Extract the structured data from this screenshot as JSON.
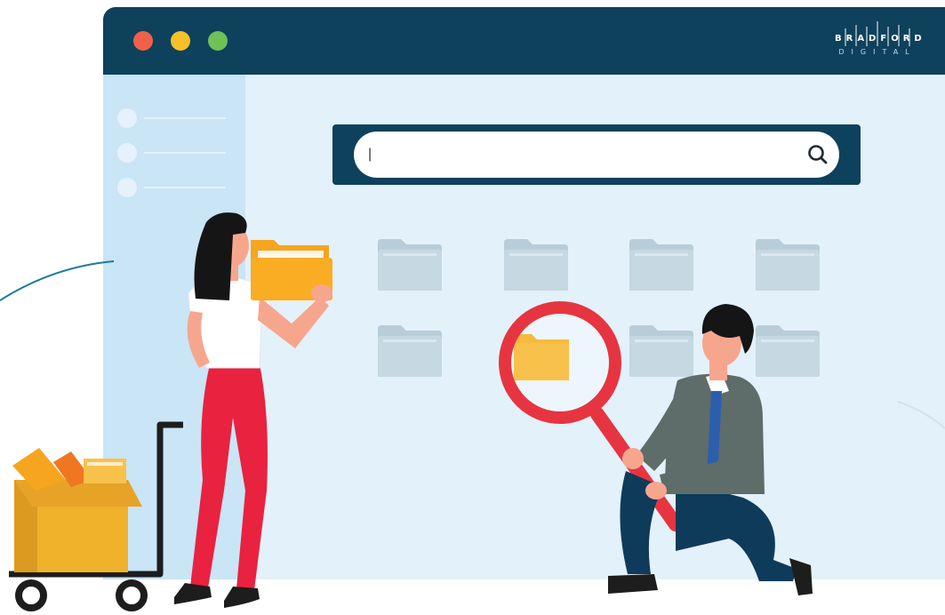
{
  "window": {
    "brand": {
      "name_top": "BRADFORD",
      "name_bottom": "DIGITAL"
    },
    "window_controls": [
      "close",
      "minimize",
      "maximize"
    ]
  },
  "search": {
    "value": "|",
    "placeholder": "",
    "icon": "search-icon"
  },
  "sidebar": {
    "items": [
      {},
      {},
      {}
    ]
  },
  "folders": {
    "rows": 2,
    "cols": 4
  },
  "colors": {
    "titlebar": "#0e415c",
    "window_bg": "#e3f1fb",
    "sidebar_bg": "#c9e5f6",
    "folder_gray": "#c6d8e2",
    "folder_yellow": "#f8ad23",
    "magnifier_red": "#e63540",
    "pants_red": "#e92240",
    "accent_teal": "#1a7aa1"
  }
}
